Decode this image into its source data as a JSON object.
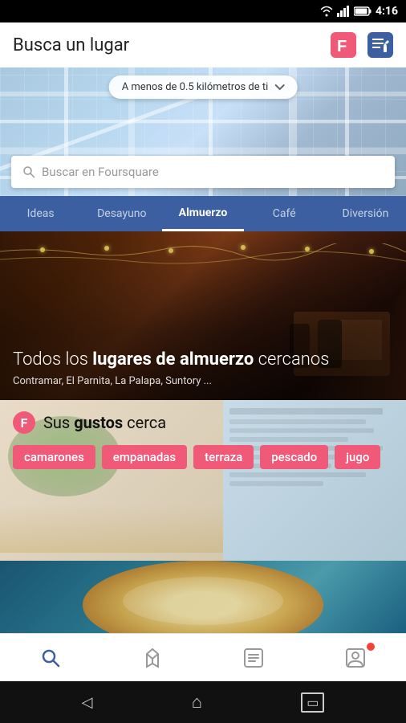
{
  "statusBar": {
    "time": "4:16"
  },
  "header": {
    "title": "Busca un lugar",
    "foursquareIconLabel": "foursquare-logo",
    "editIconLabel": "edit-list-icon"
  },
  "map": {
    "locationPill": "A menos de 0.5 kilómetros de ti",
    "searchPlaceholder": "Buscar en Foursquare"
  },
  "categories": {
    "tabs": [
      {
        "id": "ideas",
        "label": "Ideas"
      },
      {
        "id": "desayuno",
        "label": "Desayuno"
      },
      {
        "id": "almuerzo",
        "label": "Almuerzo",
        "active": true
      },
      {
        "id": "cafe",
        "label": "Café"
      },
      {
        "id": "diversion",
        "label": "Diversión"
      }
    ]
  },
  "cards": {
    "nearby": {
      "titlePart1": "Todos los ",
      "titleBold": "lugares de almuerzo",
      "titlePart2": " cercanos",
      "subtitle": "Contramar, El Parnita, La Palapa, Suntory ..."
    },
    "tastes": {
      "headerText1": "Sus ",
      "headerBold": "gustos",
      "headerText2": " cerca",
      "tags": [
        "camarones",
        "empanadas",
        "terraza",
        "pescado",
        "jugo"
      ]
    }
  },
  "bottomNav": {
    "items": [
      {
        "id": "search",
        "label": "Buscar",
        "active": true
      },
      {
        "id": "checkin",
        "label": "Check-in"
      },
      {
        "id": "list",
        "label": "Lista"
      },
      {
        "id": "profile",
        "label": "Perfil",
        "badge": true
      }
    ]
  },
  "androidNav": {
    "back": "◁",
    "home": "⬡",
    "recent": "▭"
  }
}
